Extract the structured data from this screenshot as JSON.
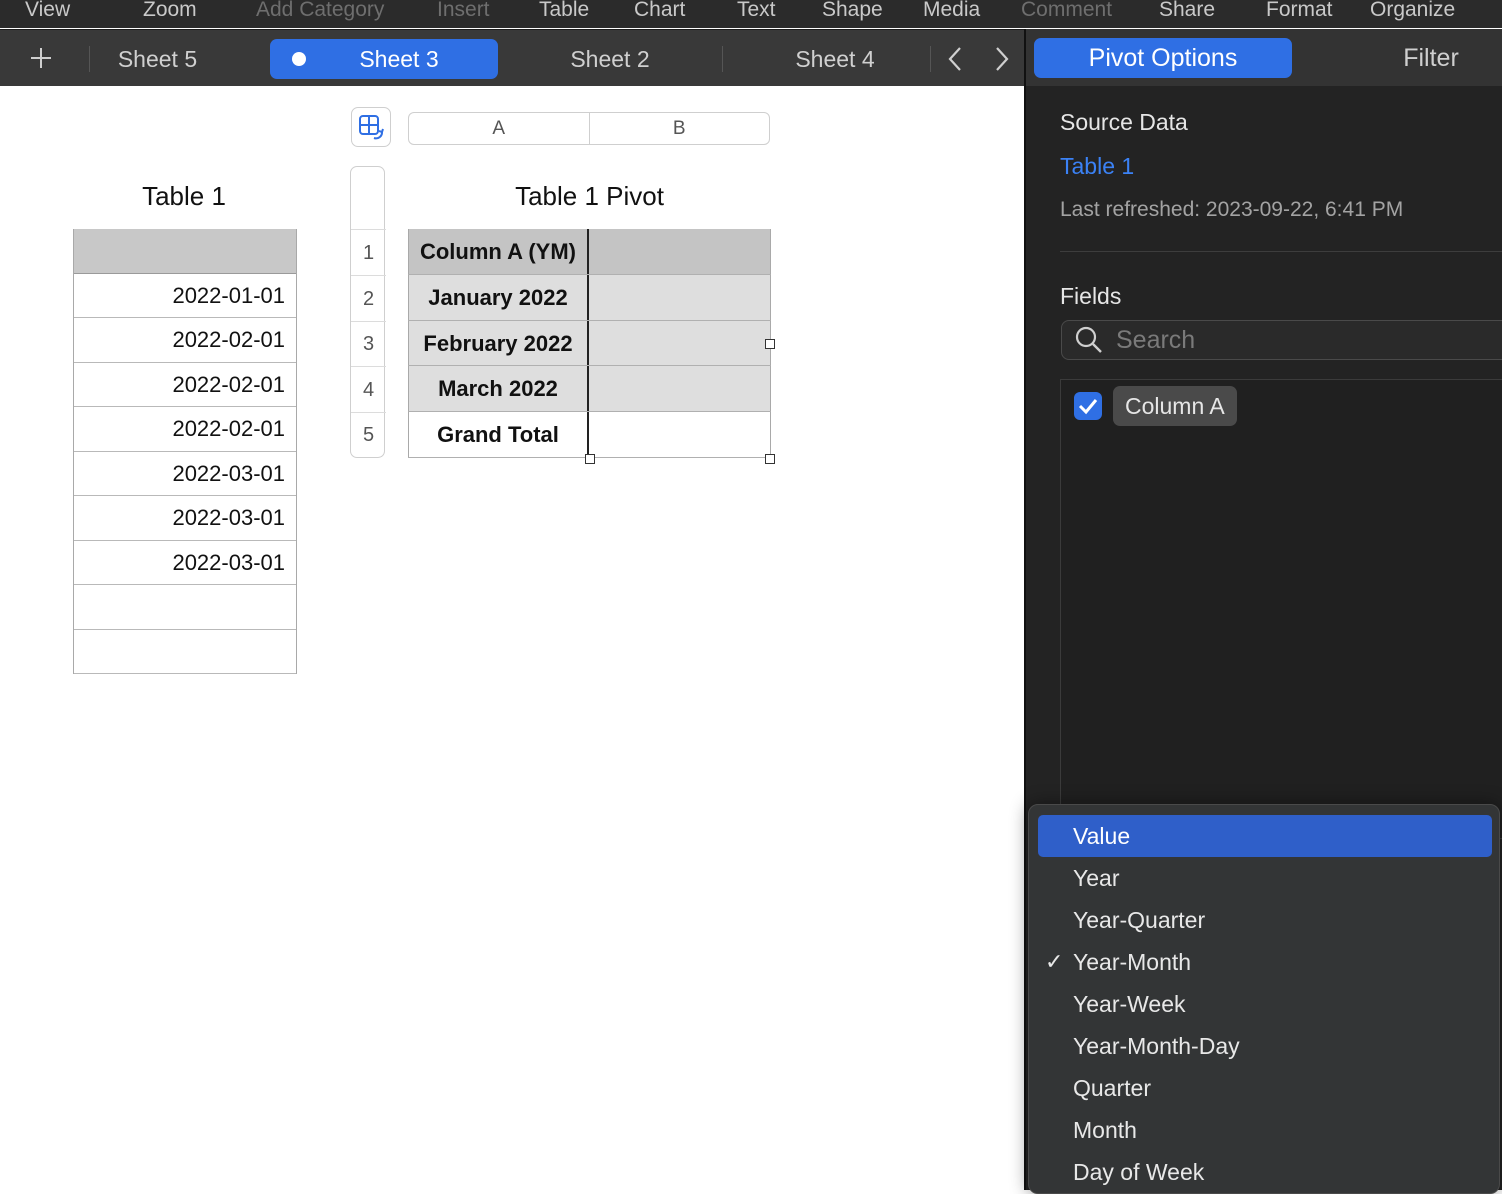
{
  "toolbar": {
    "items": [
      "View",
      "Zoom",
      "Add Category",
      "Insert",
      "Table",
      "Chart",
      "Text",
      "Shape",
      "Media",
      "Comment",
      "Share",
      "Format",
      "Organize"
    ]
  },
  "tabs": {
    "add_icon": "plus-icon",
    "items": [
      "Sheet 5",
      "Sheet 3",
      "Sheet 2",
      "Sheet 4"
    ],
    "active": "Sheet 3",
    "prev_icon": "chevron-left-icon",
    "next_icon": "chevron-right-icon"
  },
  "table1": {
    "title": "Table 1",
    "header": "",
    "rows": [
      "2022-01-01",
      "2022-02-01",
      "2022-02-01",
      "2022-02-01",
      "2022-03-01",
      "2022-03-01",
      "2022-03-01",
      "",
      ""
    ]
  },
  "pivot": {
    "title": "Table 1 Pivot",
    "col_headers": [
      "A",
      "B"
    ],
    "row_numbers": [
      "1",
      "2",
      "3",
      "4",
      "5"
    ],
    "header_label": "Column A (YM)",
    "rows": [
      "January 2022",
      "February 2022",
      "March 2022"
    ],
    "total_label": "Grand Total"
  },
  "sidebar": {
    "tabs": [
      "Pivot Options",
      "Filter"
    ],
    "source_label": "Source Data",
    "source_link": "Table 1",
    "last_refreshed": "Last refreshed: 2023-09-22, 6:41 PM",
    "fields_label": "Fields",
    "search_placeholder": "Search",
    "fields": [
      {
        "name": "Column A",
        "checked": true
      }
    ]
  },
  "menu": {
    "items": [
      "Value",
      "Year",
      "Year-Quarter",
      "Year-Month",
      "Year-Week",
      "Year-Month-Day",
      "Quarter",
      "Month",
      "Day of Week"
    ],
    "highlighted": "Value",
    "checked": "Year-Month",
    "check_glyph": "✓"
  },
  "colors": {
    "accent": "#2f6fe4",
    "link": "#3b82f6",
    "menu_highlight": "#2f5fc9"
  }
}
